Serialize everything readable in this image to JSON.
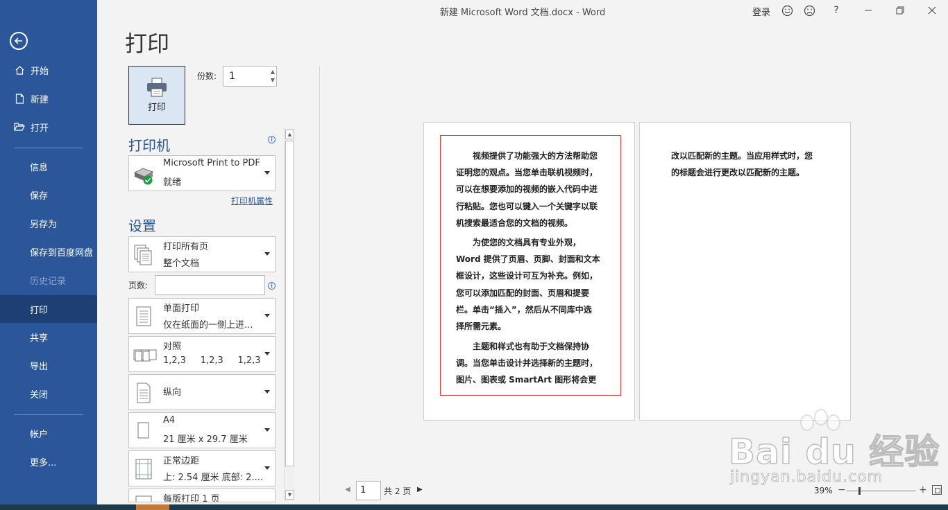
{
  "window": {
    "title": "新建 Microsoft Word 文档.docx  -  Word",
    "login": "登录"
  },
  "sidebar": {
    "items": [
      {
        "label": "开始",
        "icon": "home-icon"
      },
      {
        "label": "新建",
        "icon": "new-document-icon"
      },
      {
        "label": "打开",
        "icon": "open-folder-icon"
      },
      {
        "label": "信息"
      },
      {
        "label": "保存"
      },
      {
        "label": "另存为"
      },
      {
        "label": "保存到百度网盘"
      },
      {
        "label": "历史记录",
        "disabled": true
      },
      {
        "label": "打印",
        "active": true
      },
      {
        "label": "共享"
      },
      {
        "label": "导出"
      },
      {
        "label": "关闭"
      },
      {
        "label": "帐户"
      },
      {
        "label": "更多..."
      }
    ]
  },
  "print": {
    "title": "打印",
    "button_label": "打印",
    "copies_label": "份数:",
    "copies_value": "1"
  },
  "printer": {
    "heading": "打印机",
    "name": "Microsoft Print to PDF",
    "status": "就绪",
    "properties_link": "打印机属性"
  },
  "settings": {
    "heading": "设置",
    "pages_label": "页数:",
    "pages_value": "",
    "options": [
      {
        "line1": "打印所有页",
        "line2": "整个文档"
      },
      {
        "line1": "单面打印",
        "line2": "仅在纸面的一侧上进..."
      },
      {
        "line1": "对照",
        "line2": "1,2,3     1,2,3     1,2,3"
      },
      {
        "line1": "纵向",
        "line2": ""
      },
      {
        "line1": "A4",
        "line2": "21 厘米 x 29.7 厘米"
      },
      {
        "line1": "正常边距",
        "line2": "上: 2.54 厘米 底部: 2...."
      },
      {
        "line1": "每版打印 1 页",
        "line2": ""
      }
    ]
  },
  "preview": {
    "page1": [
      [
        "　　视频提供了功能强大的方法帮助您",
        "证明您的观点。当您单击联机视频时，",
        "可以在想要添加的视频的嵌入代码中进",
        "行粘贴。您也可以键入一个关键字以联",
        "机搜索最适合您的文档的视频。"
      ],
      [
        "　　为使您的文档具有专业外观，",
        "Word 提供了页眉、页脚、封面和文本",
        "框设计，这些设计可互为补充。例如，",
        "您可以添加匹配的封面、页眉和提要",
        "栏。单击“插入”，然后从不同库中选",
        "择所需元素。"
      ],
      [
        "　　主题和样式也有助于文档保持协",
        "调。当您单击设计并选择新的主题时，",
        "图片、图表或 SmartArt 图形将会更"
      ]
    ],
    "page2": [
      "改以匹配新的主题。当应用样式时，您",
      "的标题会进行更改以匹配新的主题。"
    ]
  },
  "nav": {
    "current_page": "1",
    "total": "共 2 页",
    "zoom": "39%"
  },
  "watermark": {
    "text": "Bai du 经验",
    "sub": "jingyan.baidu.com"
  }
}
